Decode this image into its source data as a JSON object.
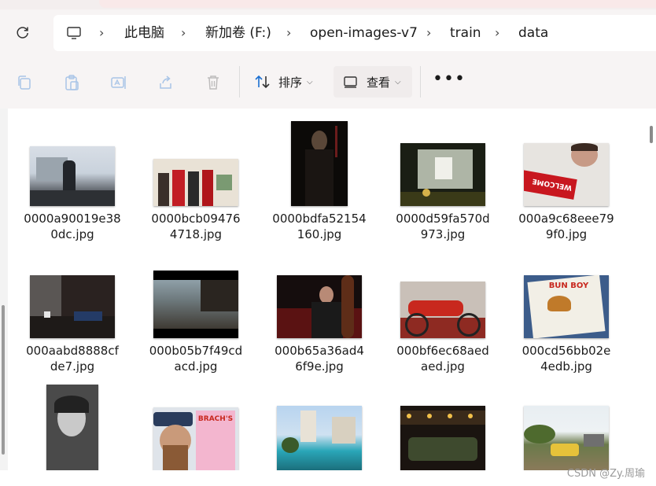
{
  "breadcrumbs": [
    "此电脑",
    "新加卷 (F:)",
    "open-images-v7",
    "train",
    "data"
  ],
  "toolbar": {
    "sort_label": "排序",
    "view_label": "查看",
    "more_label": "•••"
  },
  "files": [
    {
      "name": "0000a90019e380dc.jpg",
      "line1": "0000a90019e38",
      "line2": "0dc.jpg"
    },
    {
      "name": "0000bcb094764718.jpg",
      "line1": "0000bcb09476",
      "line2": "4718.jpg"
    },
    {
      "name": "0000bdfa52154160.jpg",
      "line1": "0000bdfa52154",
      "line2": "160.jpg"
    },
    {
      "name": "0000d59fa570d973.jpg",
      "line1": "0000d59fa570d",
      "line2": "973.jpg"
    },
    {
      "name": "000a9c68eee799f0.jpg",
      "line1": "000a9c68eee79",
      "line2": "9f0.jpg"
    },
    {
      "name": "000aabd8888cfde7.jpg",
      "line1": "000aabd8888cf",
      "line2": "de7.jpg"
    },
    {
      "name": "000b05b7f49cdacd.jpg",
      "line1": "000b05b7f49cd",
      "line2": "acd.jpg"
    },
    {
      "name": "000b65a36ad46f9e.jpg",
      "line1": "000b65a36ad4",
      "line2": "6f9e.jpg"
    },
    {
      "name": "000bf6ec68aedaed.jpg",
      "line1": "000bf6ec68aed",
      "line2": "aed.jpg"
    },
    {
      "name": "000cd56bb02e4edb.jpg",
      "line1": "000cd56bb02e",
      "line2": "4edb.jpg"
    },
    {
      "name": "",
      "line1": "",
      "line2": ""
    },
    {
      "name": "",
      "line1": "",
      "line2": ""
    },
    {
      "name": "",
      "line1": "",
      "line2": ""
    },
    {
      "name": "",
      "line1": "",
      "line2": ""
    },
    {
      "name": "",
      "line1": "",
      "line2": ""
    }
  ],
  "thumb_text": {
    "welcome": "WELCOME",
    "bun_boy": "BUN BOY",
    "brachs": "BRACH'S"
  },
  "watermark": "CSDN @Zy.周瑜",
  "colors": {
    "accent": "#1b6fd1",
    "toolbar_bg": "#f7f4f4"
  }
}
